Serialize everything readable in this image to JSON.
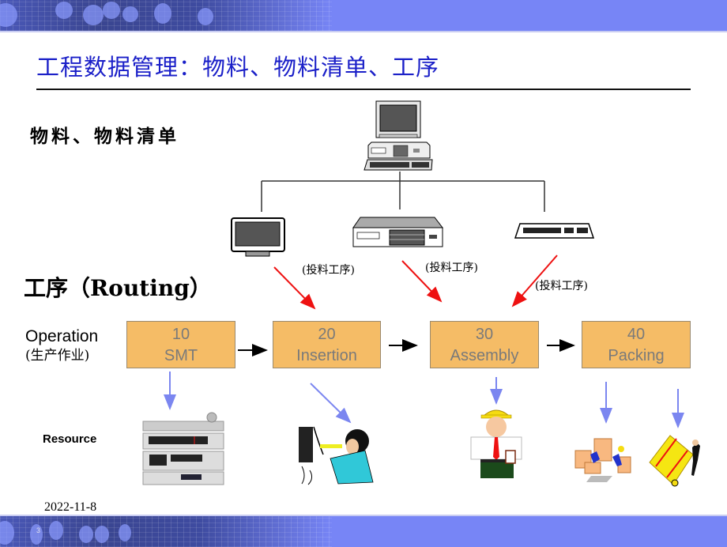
{
  "slide": {
    "title": "工程数据管理：物料、物料清单、工序",
    "date": "2022-11-8",
    "page_number": "3"
  },
  "bom_section": {
    "label": "物料、物料清单",
    "parent_item": "computer-set-icon",
    "child_items": [
      "monitor-icon",
      "cpu-unit-icon",
      "keyboard-icon"
    ]
  },
  "routing_section": {
    "label": "工序（Routing）",
    "operation_label": "Operation",
    "operation_label_cn": "(生产作业)",
    "resource_label": "Resource",
    "input_label": "(投料工序)",
    "operations": [
      {
        "number": "10",
        "name": "SMT"
      },
      {
        "number": "20",
        "name": "Insertion"
      },
      {
        "number": "30",
        "name": "Assembly"
      },
      {
        "number": "40",
        "name": "Packing"
      }
    ],
    "resources": [
      "stereo-equipment-icon",
      "worker-drilling-icon",
      "engineer-hardhat-icon",
      "workers-boxes-icon",
      "hand-truck-crate-icon"
    ]
  },
  "colors": {
    "title": "#1a1fc8",
    "banner": "#7785f6",
    "operation_box": "#f5bc66",
    "input_arrow": "#ee1111",
    "resource_arrow": "#7b86f0"
  }
}
